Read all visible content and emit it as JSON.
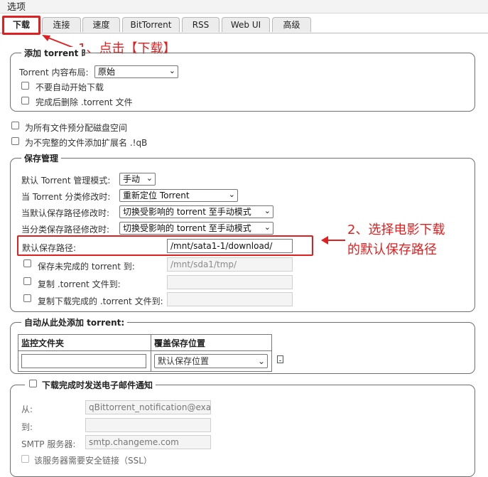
{
  "window": {
    "title": "选项"
  },
  "tabs": [
    {
      "label": "下载",
      "active": true
    },
    {
      "label": "连接"
    },
    {
      "label": "速度"
    },
    {
      "label": "BitTorrent"
    },
    {
      "label": "RSS"
    },
    {
      "label": "Web UI"
    },
    {
      "label": "高级"
    }
  ],
  "annotations": {
    "step1": "1、点击【下载】",
    "step2_line1": "2、选择电影下载",
    "step2_line2": "的默认保存路径",
    "color": "#e02020"
  },
  "add_torrent": {
    "legend": "添加 torrent 时",
    "layout_label": "Torrent 内容布局:",
    "layout_value": "原始",
    "no_autostart_label": "不要自动开始下载",
    "delete_after_label": "完成后删除 .torrent 文件"
  },
  "preallocate_label": "为所有文件预分配磁盘空间",
  "append_ext_label": "为不完整的文件添加扩展名 .!qB",
  "save_mgmt": {
    "legend": "保存管理",
    "default_mode_label": "默认 Torrent 管理模式:",
    "default_mode_value": "手动",
    "category_changed_label": "当 Torrent 分类修改时:",
    "category_changed_value": "重新定位 Torrent",
    "default_path_changed_label": "当默认保存路径修改时:",
    "default_path_changed_value": "切换受影响的 torrent 至手动模式",
    "category_path_changed_label": "当分类保存路径修改时:",
    "category_path_changed_value": "切换受影响的 torrent 至手动模式",
    "default_save_path_label": "默认保存路径:",
    "default_save_path_value": "/mnt/sata1-1/download/",
    "incomplete_label": "保存未完成的 torrent 到:",
    "incomplete_value": "/mnt/sda1/tmp/",
    "copy_torrent_label": "复制 .torrent 文件到:",
    "copy_finished_label": "复制下载完成的 .torrent 文件到:"
  },
  "auto_add": {
    "legend": "自动从此处添加 torrent:",
    "col_watch": "监控文件夹",
    "col_override": "覆盖保存位置",
    "override_value": "默认保存位置"
  },
  "email": {
    "legend": "下载完成时发送电子邮件通知",
    "from_label": "从:",
    "from_value": "qBittorrent_notification@exa",
    "to_label": "到:",
    "smtp_label": "SMTP 服务器:",
    "smtp_value": "smtp.changeme.com",
    "ssl_label": "该服务器需要安全链接（SSL）"
  }
}
